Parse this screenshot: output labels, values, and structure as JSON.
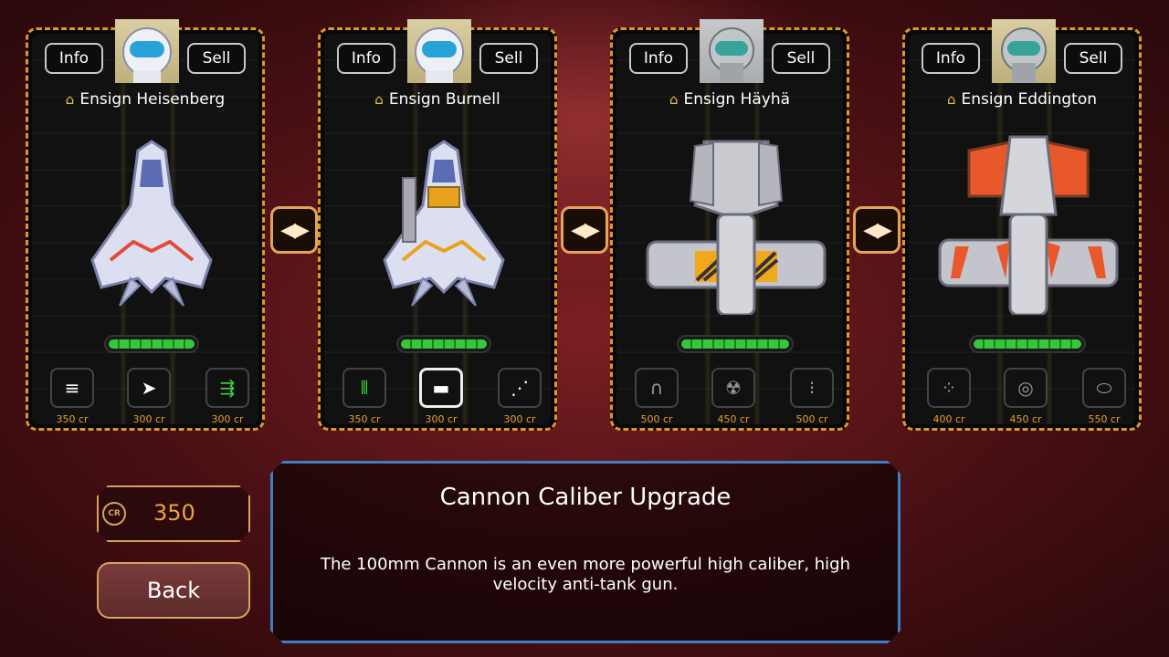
{
  "cards": [
    {
      "info_label": "Info",
      "sell_label": "Sell",
      "rank_icon": "chevron-rank-icon",
      "pilot": "Ensign Heisenberg",
      "portrait": "astronaut-helmet",
      "ship_color": "#e24a3a",
      "health_fraction": 1.0,
      "upgrades": [
        {
          "icon": "twin-bullets-icon",
          "price": "350 cr",
          "active": false,
          "green": false
        },
        {
          "icon": "missile-icon",
          "price": "300 cr",
          "active": false,
          "green": false
        },
        {
          "icon": "laser-plus-icon",
          "price": "300 cr",
          "active": false,
          "green": true
        }
      ]
    },
    {
      "info_label": "Info",
      "sell_label": "Sell",
      "rank_icon": "chevron-rank-icon",
      "pilot": "Ensign Burnell",
      "portrait": "astronaut-helmet",
      "ship_color": "#e8a21f",
      "health_fraction": 1.0,
      "upgrades": [
        {
          "icon": "gatling-icon",
          "price": "350 cr",
          "active": false,
          "green": true
        },
        {
          "icon": "cannon-caliber-icon",
          "price": "300 cr",
          "active": true,
          "green": false
        },
        {
          "icon": "spread-shot-icon",
          "price": "300 cr",
          "active": false,
          "green": false
        }
      ]
    },
    {
      "info_label": "Info",
      "sell_label": "Sell",
      "rank_icon": "chevron-rank-icon",
      "pilot": "Ensign Häyhä",
      "portrait": "robot-helmet",
      "ship_color": "#f0a81d",
      "health_fraction": 1.0,
      "upgrades": [
        {
          "icon": "magnet-icon",
          "price": "500 cr",
          "active": false,
          "green": false
        },
        {
          "icon": "radiation-icon",
          "price": "450 cr",
          "active": false,
          "green": false
        },
        {
          "icon": "ammo-icon",
          "price": "500 cr",
          "active": false,
          "green": false
        }
      ]
    },
    {
      "info_label": "Info",
      "sell_label": "Sell",
      "rank_icon": "chevron-rank-icon",
      "pilot": "Ensign Eddington",
      "portrait": "robot-helmet",
      "ship_color": "#e8582a",
      "health_fraction": 1.0,
      "upgrades": [
        {
          "icon": "cluster-icon",
          "price": "400 cr",
          "active": false,
          "green": false
        },
        {
          "icon": "pulse-icon",
          "price": "450 cr",
          "active": false,
          "green": false
        },
        {
          "icon": "shield-blade-icon",
          "price": "550 cr",
          "active": false,
          "green": false
        }
      ]
    }
  ],
  "swap_icon": "swap-arrows-icon",
  "credits": {
    "icon_label": "CR",
    "value": "350"
  },
  "back_label": "Back",
  "description": {
    "title": "Cannon Caliber Upgrade",
    "body": "The 100mm Cannon is an even more powerful high caliber, high velocity anti-tank gun."
  },
  "colors": {
    "accent": "#e2952a",
    "price": "#e79d2e",
    "panel_border": "#3d7fc2",
    "health": "#35c93a"
  }
}
